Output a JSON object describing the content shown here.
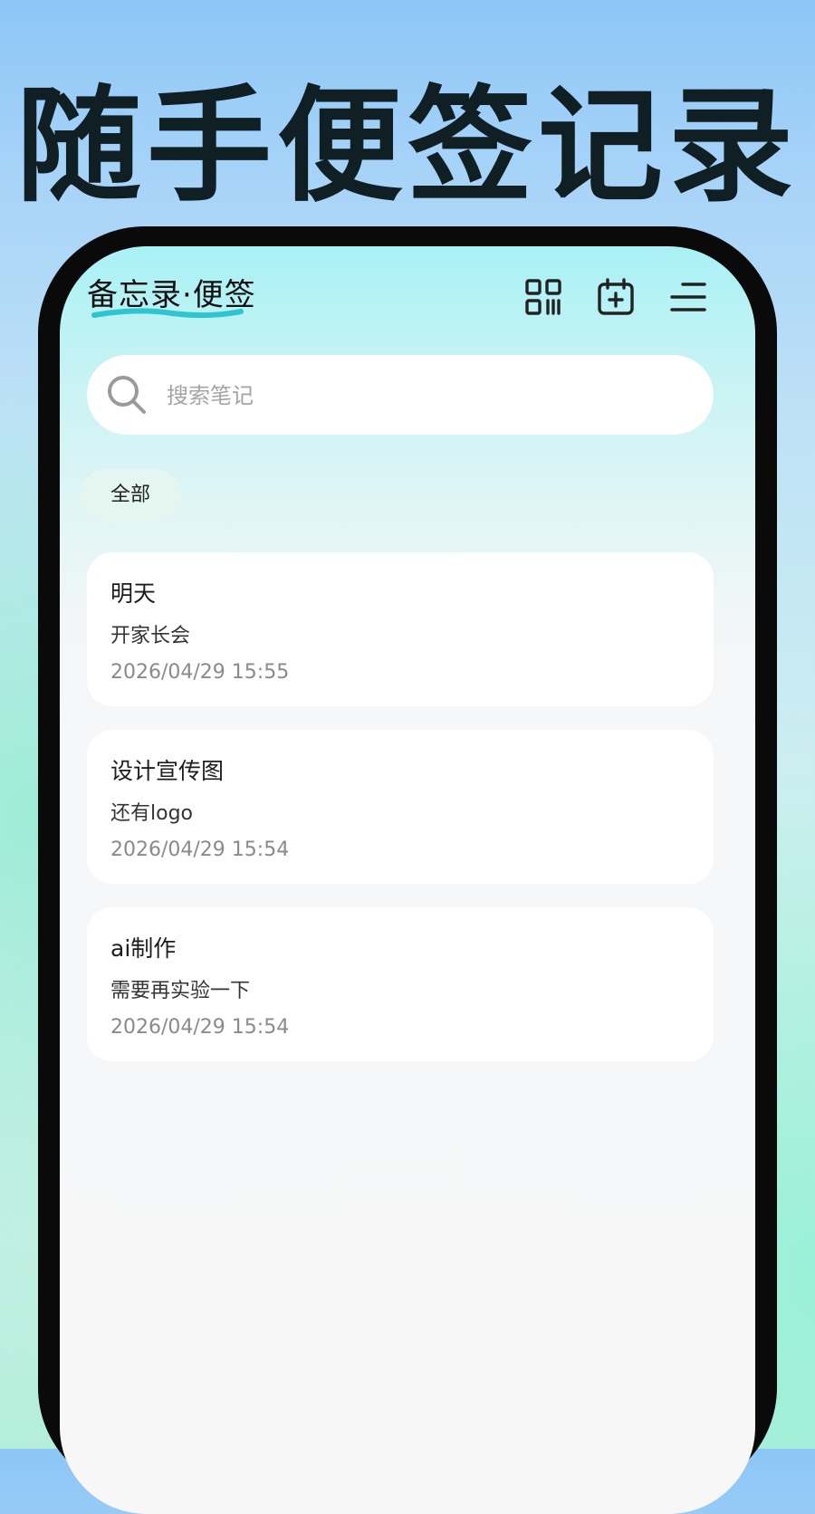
{
  "promo": {
    "headline": "随手便签记录"
  },
  "app": {
    "title": "备忘录·便签",
    "accent": "#2ec4d0",
    "icons": [
      "qr-code-icon",
      "calendar-add-icon",
      "menu-icon"
    ]
  },
  "search": {
    "placeholder": "搜索笔记",
    "value": ""
  },
  "filter": {
    "active_chip": "全部"
  },
  "notes": [
    {
      "title": "明天",
      "body": "开家长会",
      "time": "2026/04/29 15:55"
    },
    {
      "title": "设计宣传图",
      "body": "还有logo",
      "time": "2026/04/29 15:54"
    },
    {
      "title": "ai制作",
      "body": "需要再实验一下",
      "time": "2026/04/29 15:54"
    }
  ]
}
